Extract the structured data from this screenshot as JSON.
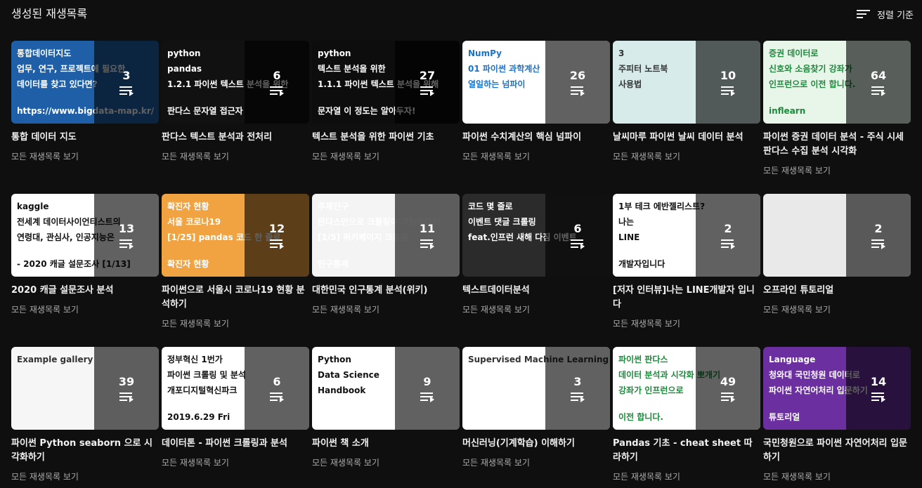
{
  "header": {
    "title": "생성된 재생목록",
    "sort_label": "정렬 기준"
  },
  "view_all_label": "모든 재생목록 보기",
  "playlists": [
    {
      "title": "통합 데이터 지도",
      "count": "3",
      "art": [
        "통합데이터지도",
        "업무, 연구, 프로젝트에 필요한",
        "데이터를 찾고 있다면?",
        "https://www.bigdata-map.kr/"
      ],
      "bg": "#1f5fa8",
      "fg": "#ffffff"
    },
    {
      "title": "판다스 텍스트 분석과 전처리",
      "count": "6",
      "art": [
        "python",
        "pandas",
        "1.2.1 파이썬 텍스트 분석을 위한",
        "판다스 문자열 접근자"
      ],
      "bg": "#111111",
      "fg": "#ffffff"
    },
    {
      "title": "텍스트 분석을 위한 파이썬 기초",
      "count": "27",
      "art": [
        "python",
        "텍스트 분석을 위한",
        "1.1.1 파이썬 텍스트 분석을 위해",
        "문자열 이 정도는 알아두자!"
      ],
      "bg": "#0d0d0d",
      "fg": "#ffffff"
    },
    {
      "title": "파이썬 수치계산의 핵심 넘파이",
      "count": "26",
      "art": [
        "NumPy",
        "01 파이썬 과학계산",
        "열일하는 넘파이",
        ""
      ],
      "bg": "#ffffff",
      "fg": "#1a73c8"
    },
    {
      "title": "날씨마루 파이썬 날씨 데이터 분석",
      "count": "10",
      "art": [
        "3",
        "주피터 노트북",
        "사용법",
        ""
      ],
      "bg": "#d7ecea",
      "fg": "#333333"
    },
    {
      "title": "파이썬 증권 데이터 분석 - 주식 시세 판다스 수집 분석 시각화",
      "count": "64",
      "art": [
        "증권 데이터로",
        "신호와 소음찾기 강좌가",
        "인프런으로 이전 합니다.",
        "inflearn"
      ],
      "bg": "#e8f6ea",
      "fg": "#1b8a3a"
    },
    {
      "title": "2020 캐글 설문조사 분석",
      "count": "13",
      "art": [
        "kaggle",
        "전세계 데이터사이언티스트의",
        "연령대, 관심사, 인공지능은",
        "- 2020 캐글 설문조사 [1/13]"
      ],
      "bg": "#ffffff",
      "fg": "#111111"
    },
    {
      "title": "파이썬으로 서울시 코로나19 현황 분석하기",
      "count": "12",
      "art": [
        "확진자 현황",
        "서울 코로나19",
        "[1/25] pandas 코드 한 줄로",
        "확진자 현황"
      ],
      "bg": "#f2a341",
      "fg": "#ffffff"
    },
    {
      "title": "대한민국 인구통계 분석(위키)",
      "count": "11",
      "art": [
        "주제단구",
        "판다스만으로 크롤링이 가능하다?!",
        "[1/5] 위키페이지 크롤링",
        "인구통계"
      ],
      "bg": "#f4f4f4",
      "fg": "#ffffff"
    },
    {
      "title": "텍스트데이터분석",
      "count": "6",
      "art": [
        "코드 몇 줄로",
        "이벤트 댓글 크롤링",
        "feat.인프런 새해 다짐 이벤트",
        ""
      ],
      "bg": "#2b2b2b",
      "fg": "#ffffff"
    },
    {
      "title": "[저자 인터뷰]나는 LINE개발자 입니다",
      "count": "2",
      "art": [
        "1부 테크 에반젤리스트?",
        "나는",
        "LINE",
        "개발자입니다"
      ],
      "bg": "#ffffff",
      "fg": "#111111"
    },
    {
      "title": "오프라인 튜토리얼",
      "count": "2",
      "art": [
        "",
        "",
        "",
        ""
      ],
      "bg": "#e9e9e9",
      "fg": "#333333"
    },
    {
      "title": "파이썬 Python seaborn 으로 시각화하기",
      "count": "39",
      "art": [
        "Example gallery",
        "",
        "",
        ""
      ],
      "bg": "#f6f6f6",
      "fg": "#333333"
    },
    {
      "title": "데이터톤 - 파이썬 크롤링과 분석",
      "count": "6",
      "art": [
        "정부혁신 1번가",
        "파이썬 크롤링 및 분석",
        "개포디지털혁신파크",
        "2019.6.29 Fri"
      ],
      "bg": "#ffffff",
      "fg": "#111111"
    },
    {
      "title": "파이썬 책 소개",
      "count": "9",
      "art": [
        "Python",
        "Data Science",
        "Handbook",
        ""
      ],
      "bg": "#ffffff",
      "fg": "#111111"
    },
    {
      "title": "머신러닝(기계학습) 이해하기",
      "count": "3",
      "art": [
        "Supervised Machine Learning",
        "",
        "",
        ""
      ],
      "bg": "#ffffff",
      "fg": "#333333"
    },
    {
      "title": "Pandas 기초 - cheat sheet 따라하기",
      "count": "49",
      "art": [
        "파이썬 판다스",
        "데이터 분석과 시각화 뽀개기",
        "강좌가 인프런으로",
        "이전 합니다."
      ],
      "bg": "#ffffff",
      "fg": "#1b8a3a"
    },
    {
      "title": "국민청원으로 파이썬 자연어처리 입문하기",
      "count": "14",
      "art": [
        "Language",
        "청와대 국민청원 데이터로",
        "파이썬 자연어처리 입문하기",
        "튜토리얼"
      ],
      "bg": "#6b2fa0",
      "fg": "#ffffff"
    }
  ]
}
